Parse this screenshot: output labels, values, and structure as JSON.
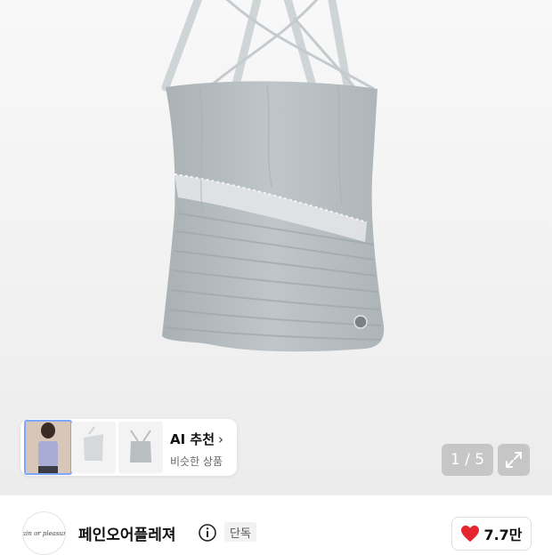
{
  "gallery": {
    "image_alt": "halter neck ruched bandeau top",
    "counter": "1 / 5",
    "expand_icon": "expand-arrows-icon"
  },
  "ai_recommend": {
    "title": "AI 추천",
    "chevron": "›",
    "subtitle": "비슷한 상품"
  },
  "brand": {
    "logo_text": "Pain or pleasure",
    "name": "페인오어플레져",
    "info_icon": "info-icon",
    "badge": "단독"
  },
  "like": {
    "icon": "heart-icon",
    "count": "7.7만",
    "color": "#e5262e"
  },
  "colors": {
    "garment": "#b9c0c4",
    "lace": "#e3e6e8"
  }
}
